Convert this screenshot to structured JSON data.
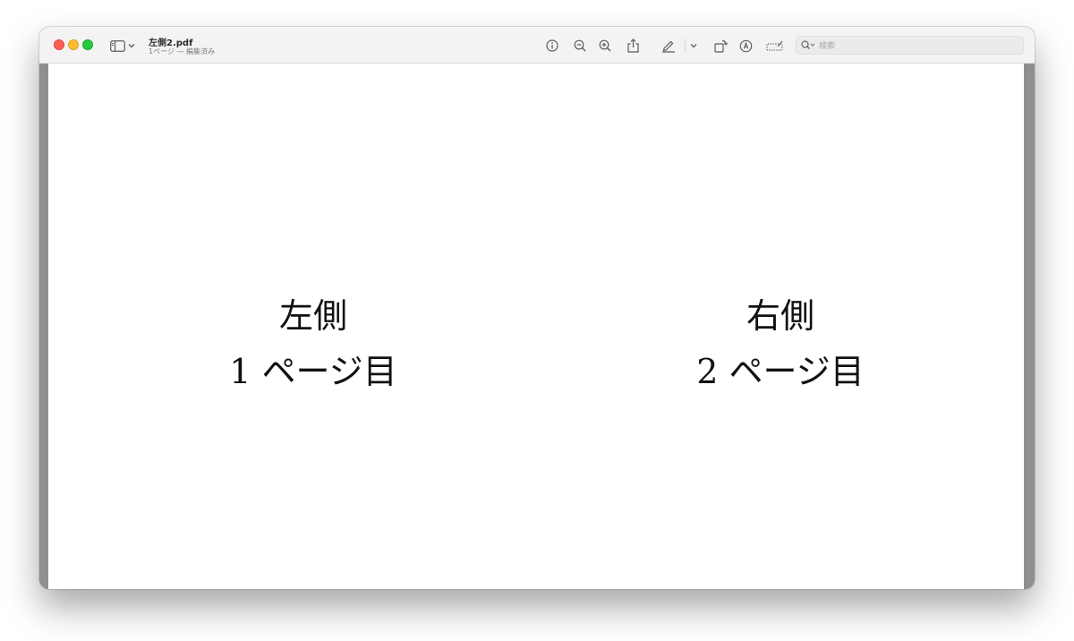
{
  "window": {
    "title": "左側2.pdf",
    "subtitle": "1ページ — 編集済み"
  },
  "toolbar": {
    "icons": [
      "sidebar-icon",
      "chevron-down-icon",
      "info-icon",
      "zoom-out-icon",
      "zoom-in-icon",
      "share-icon",
      "highlight-pen-icon",
      "chevron-down-icon",
      "rotate-icon",
      "markup-icon",
      "form-fill-icon",
      "search-icon"
    ]
  },
  "search": {
    "placeholder": "検索"
  },
  "document": {
    "left": {
      "line1": "左側",
      "line2": "1 ページ目"
    },
    "right": {
      "line1": "右側",
      "line2": "2 ページ目"
    }
  }
}
